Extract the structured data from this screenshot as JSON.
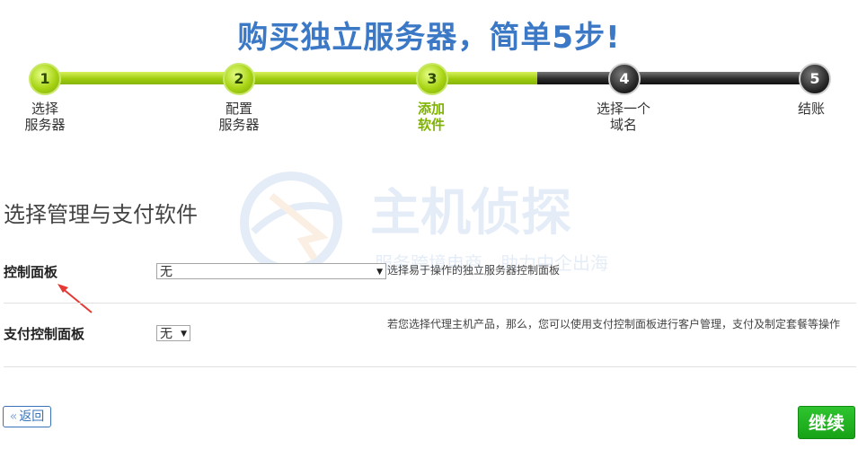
{
  "page": {
    "title": "购买独立服务器，简单5步!"
  },
  "steps": [
    {
      "num": "1",
      "lines": [
        "选择",
        "服务器"
      ],
      "state": "done"
    },
    {
      "num": "2",
      "lines": [
        "配置",
        "服务器"
      ],
      "state": "done"
    },
    {
      "num": "3",
      "lines": [
        "添加",
        "软件"
      ],
      "state": "active"
    },
    {
      "num": "4",
      "lines": [
        "选择一个",
        "域名"
      ],
      "state": "todo"
    },
    {
      "num": "5",
      "lines": [
        "结账"
      ],
      "state": "todo"
    }
  ],
  "progress": {
    "completed_steps": 3,
    "total_steps": 5
  },
  "watermark": {
    "brand": "主机侦探",
    "slogan": "服务跨境电商，助力中企出海"
  },
  "section": {
    "title": "选择管理与支付软件"
  },
  "control_panel": {
    "label": "控制面板",
    "selected": "无",
    "help": "选择易于操作的独立服务器控制面板"
  },
  "payment_panel": {
    "label": "支付控制面板",
    "selected": "无",
    "help": "若您选择代理主机产品，那么，您可以使用支付控制面板进行客户管理，支付及制定套餐等操作"
  },
  "nav": {
    "back_label": "返回",
    "next_label": "继续"
  },
  "colors": {
    "title": "#3b78c5",
    "progress_done": "#a8d414",
    "progress_todo": "#2a2a2a",
    "active_step": "#7fb300",
    "next_button": "#16a316",
    "back_button": "#3a73ba"
  },
  "icons": [
    "chevron-left-icon",
    "dropdown-arrow-icon",
    "red-arrow-annotation",
    "watermark-logo"
  ]
}
